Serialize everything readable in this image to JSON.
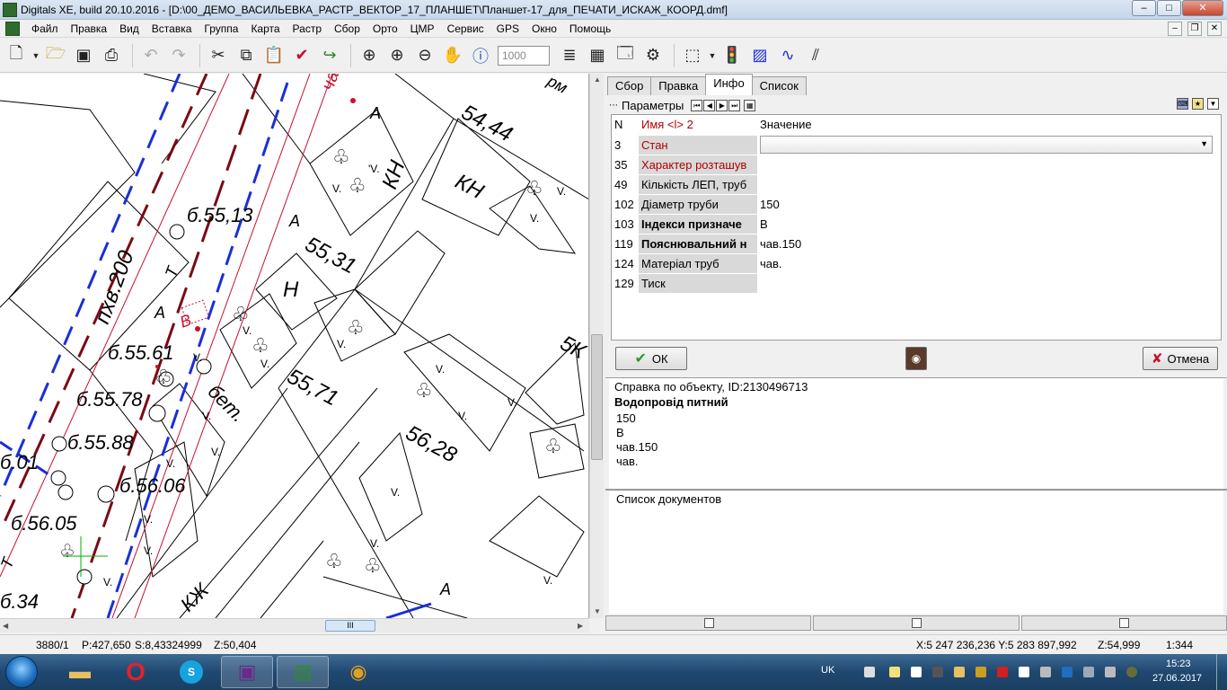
{
  "window": {
    "title": "Digitals XE, build 20.10.2016 - [D:\\00_ДЕМО_ВАСИЛЬЕВКА_РАСТР_ВЕКТОР_17_ПЛАНШЕТ\\Планшет-17_для_ПЕЧАТИ_ИСКАЖ_КООРД.dmf]",
    "minimize": "–",
    "maximize": "□",
    "close": "✕"
  },
  "menu": [
    "Файл",
    "Правка",
    "Вид",
    "Вставка",
    "Группа",
    "Карта",
    "Растр",
    "Сбор",
    "Орто",
    "ЦМР",
    "Сервис",
    "GPS",
    "Окно",
    "Помощь"
  ],
  "toolbar": {
    "scale_value": "1000",
    "icons": [
      "new-document-icon",
      "open-folder-icon",
      "save-icon",
      "print-icon",
      "undo-icon",
      "redo-icon",
      "cut-icon",
      "copy-icon",
      "paste-icon",
      "check-icon",
      "redo-arrow-icon",
      "zoom-add-icon",
      "zoom-in-icon",
      "zoom-out-icon",
      "hand-pan-icon",
      "info-icon",
      "layers-icon",
      "table-icon",
      "properties-icon",
      "settings-icon",
      "select-icon",
      "traffic-light-icon",
      "raster-icon",
      "curve-icon",
      "hatch-icon"
    ]
  },
  "map": {
    "labels": {
      "l1": "54,44",
      "l2": "КН",
      "l3": "КН",
      "l4": "б.55,13",
      "l5": "пхв.200",
      "l6": "55,31",
      "l7": "Н",
      "l8": "б.55.61",
      "l9": "б.55.78",
      "l10": "55,71",
      "l11": "бет.",
      "l12": "56,28",
      "l13": "б.55.88",
      "l14": "б.01",
      "l15": "б.56.06",
      "l16": "б.56.05",
      "l17": "5К",
      "l18": "б.34",
      "l19": "КЖ",
      "l20": "В",
      "l21": "ча",
      "l22": "А",
      "l23": "Т",
      "l24": "рм"
    }
  },
  "panel": {
    "tabs": [
      "Сбор",
      "Правка",
      "Инфо",
      "Список"
    ],
    "active_tab": "Инфо",
    "params_title": "Параметры",
    "grid": {
      "header": {
        "n": "N",
        "name": "Имя <l> 2",
        "value": "Значение"
      },
      "rows": [
        {
          "n": "3",
          "name": "Стан",
          "value": ""
        },
        {
          "n": "35",
          "name": "Характер розташув",
          "value": ""
        },
        {
          "n": "49",
          "name": "Кількість ЛЕП, труб",
          "value": ""
        },
        {
          "n": "102",
          "name": "Діаметр труби",
          "value": "150"
        },
        {
          "n": "103",
          "name": "Індекси призначе",
          "value": "В"
        },
        {
          "n": "119",
          "name": "Пояснювальний н",
          "value": "чав.150"
        },
        {
          "n": "124",
          "name": "Матеріал труб",
          "value": "чав."
        },
        {
          "n": "129",
          "name": "Тиск",
          "value": ""
        }
      ]
    },
    "ok_label": "ОК",
    "cancel_label": "Отмена",
    "info": {
      "header": "Справка по объекту, ID:2130496713",
      "title": "Водопровід питний",
      "lines": [
        "150",
        "В",
        "чав.150",
        "чав."
      ]
    },
    "docs_label": "Список документов"
  },
  "status": {
    "obj": "3880/1",
    "p": "P:427,650",
    "s": "S:8,43324999",
    "z": "Z:50,404",
    "xy": "X:5 247 236,236 Y:5 283 897,992",
    "z2": "Z:54,999",
    "scale": "1:344"
  },
  "taskbar": {
    "lang": "UK",
    "time": "15:23",
    "date": "27.06.2017"
  },
  "colors": {
    "red_line": "#c8102e",
    "blue_line": "#1a2fd6",
    "darkred_line": "#7a0a14",
    "green_cursor": "#00b000"
  }
}
